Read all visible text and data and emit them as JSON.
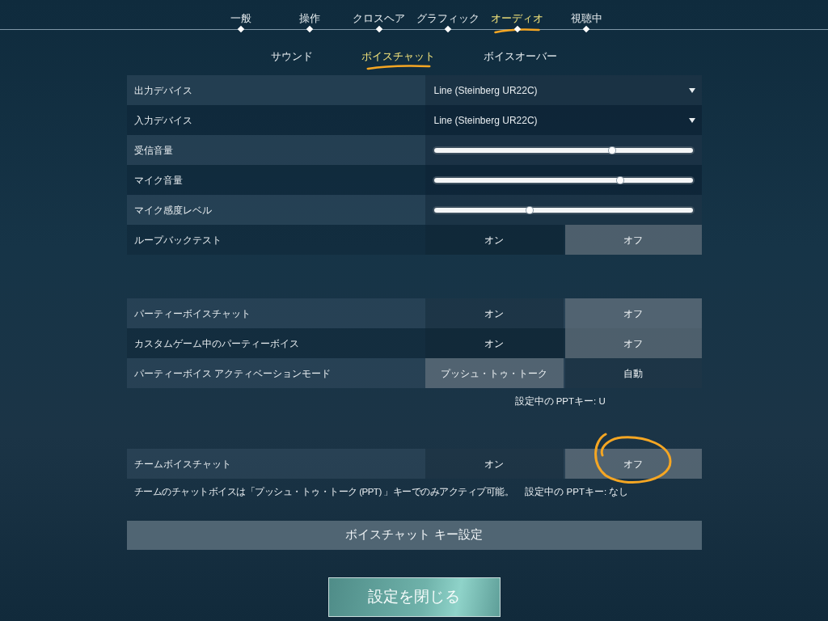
{
  "main_tabs": [
    {
      "label": "一般",
      "selected": false,
      "annotated": false
    },
    {
      "label": "操作",
      "selected": false,
      "annotated": false
    },
    {
      "label": "クロスヘア",
      "selected": false,
      "annotated": false
    },
    {
      "label": "グラフィック",
      "selected": false,
      "annotated": false
    },
    {
      "label": "オーディオ",
      "selected": true,
      "annotated": true
    },
    {
      "label": "視聴中",
      "selected": false,
      "annotated": false
    }
  ],
  "sub_tabs": [
    {
      "label": "サウンド",
      "selected": false,
      "annotated": false
    },
    {
      "label": "ボイスチャット",
      "selected": true,
      "annotated": true
    },
    {
      "label": "ボイスオーバー",
      "selected": false,
      "annotated": false
    }
  ],
  "sections": [
    {
      "rows": [
        {
          "kind": "dropdown",
          "label": "出力デバイス",
          "value": "Line (Steinberg UR22C)"
        },
        {
          "kind": "dropdown",
          "label": "入力デバイス",
          "value": "Line (Steinberg UR22C)"
        },
        {
          "kind": "slider",
          "label": "受信音量",
          "level": 0.69
        },
        {
          "kind": "slider",
          "label": "マイク音量",
          "level": 0.72
        },
        {
          "kind": "slider",
          "label": "マイク感度レベル",
          "level": 0.37
        },
        {
          "kind": "toggle",
          "label": "ループバックテスト",
          "options": [
            {
              "label": "オン",
              "selected": false,
              "annotated": false
            },
            {
              "label": "オフ",
              "selected": true,
              "annotated": false
            }
          ]
        }
      ]
    },
    {
      "rows": [
        {
          "kind": "toggle",
          "label": "パーティーボイスチャット",
          "options": [
            {
              "label": "オン",
              "selected": false,
              "annotated": false
            },
            {
              "label": "オフ",
              "selected": true,
              "annotated": false
            }
          ]
        },
        {
          "kind": "toggle",
          "label": "カスタムゲーム中のパーティーボイス",
          "options": [
            {
              "label": "オン",
              "selected": false,
              "annotated": false
            },
            {
              "label": "オフ",
              "selected": true,
              "annotated": false
            }
          ]
        },
        {
          "kind": "toggle",
          "label": "パーティーボイス アクティベーションモード",
          "options": [
            {
              "label": "プッシュ・トゥ・トーク",
              "selected": true,
              "annotated": false
            },
            {
              "label": "自動",
              "selected": false,
              "annotated": false
            }
          ]
        }
      ],
      "footer": {
        "right": "設定中の PPTキー: U"
      }
    },
    {
      "rows": [
        {
          "kind": "toggle",
          "label": "チームボイスチャット",
          "options": [
            {
              "label": "オン",
              "selected": false,
              "annotated": false
            },
            {
              "label": "オフ",
              "selected": true,
              "annotated": true
            }
          ]
        }
      ],
      "footer": {
        "left": "チームのチャットボイスは「プッシュ・トゥ・トーク (PPT) 」キーでのみアクティブ可能。",
        "right": "設定中の PPTキー: なし"
      }
    }
  ],
  "key_button": "ボイスチャット キー設定",
  "close_button": "設定を閉じる"
}
